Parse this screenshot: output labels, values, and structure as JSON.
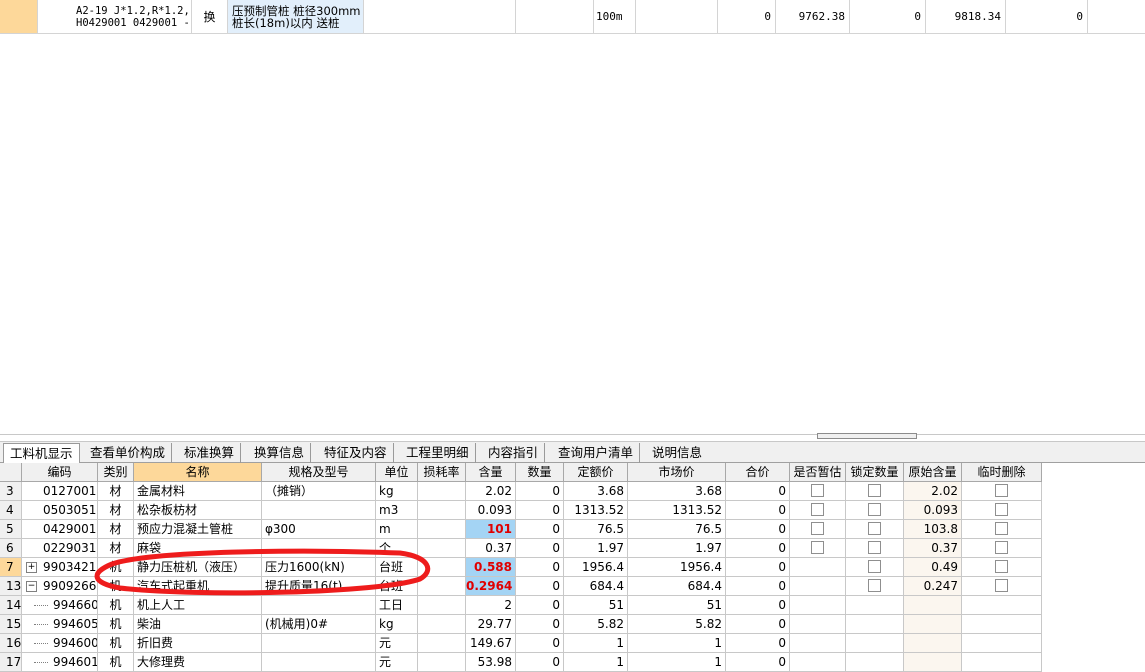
{
  "top_row": {
    "code_lines": [
      "A2-19 J*1.2,R*1.2,",
      "H0429001 0429001 -"
    ],
    "type": "换",
    "name_lines": [
      "压预制管桩 桩径300mm",
      "桩长(18m)以内 送桩"
    ],
    "unit": "100m",
    "v1": "0",
    "v2": "9762.38",
    "v3": "0",
    "v4": "9818.34",
    "v5": "0"
  },
  "tabs": [
    {
      "label": "工料机显示",
      "active": true
    },
    {
      "label": "查看单价构成"
    },
    {
      "label": "标准换算"
    },
    {
      "label": "换算信息"
    },
    {
      "label": "特征及内容"
    },
    {
      "label": "工程里明细"
    },
    {
      "label": "内容指引"
    },
    {
      "label": "查询用户清单"
    },
    {
      "label": "说明信息"
    }
  ],
  "columns": [
    "编码",
    "类别",
    "名称",
    "规格及型号",
    "单位",
    "损耗率",
    "含量",
    "数量",
    "定额价",
    "市场价",
    "合价",
    "是否暂估",
    "锁定数量",
    "原始含量",
    "临时删除"
  ],
  "rows": [
    {
      "no": "3",
      "code": "0127001",
      "type": "材",
      "name": "金属材料",
      "spec": "（摊销）",
      "unit": "kg",
      "loss": "",
      "qty": "2.02",
      "amount": "0",
      "quota": "3.68",
      "market": "3.68",
      "total": "0",
      "est": true,
      "lock": true,
      "orig": "2.02",
      "del": true
    },
    {
      "no": "4",
      "code": "0503051",
      "type": "材",
      "name": "松杂板枋材",
      "spec": "",
      "unit": "m3",
      "loss": "",
      "qty": "0.093",
      "amount": "0",
      "quota": "1313.52",
      "market": "1313.52",
      "total": "0",
      "est": true,
      "lock": true,
      "orig": "0.093",
      "del": true
    },
    {
      "no": "5",
      "code": "0429001",
      "type": "材",
      "name": "预应力混凝土管桩",
      "spec": "φ300",
      "unit": "m",
      "loss": "",
      "qty": "101",
      "amount": "0",
      "quota": "76.5",
      "market": "76.5",
      "total": "0",
      "est": true,
      "lock": true,
      "orig": "103.8",
      "del": true
    },
    {
      "no": "6",
      "code": "0229031",
      "type": "材",
      "name": "麻袋",
      "spec": "",
      "unit": "个",
      "loss": "",
      "qty": "0.37",
      "amount": "0",
      "quota": "1.97",
      "market": "1.97",
      "total": "0",
      "est": true,
      "lock": true,
      "orig": "0.37",
      "del": true
    },
    {
      "no": "7",
      "code": "9903421",
      "type": "机",
      "name": "静力压桩机（液压）",
      "spec": "压力1600(kN)",
      "unit": "台班",
      "loss": "",
      "qty": "0.588",
      "amount": "0",
      "quota": "1956.4",
      "market": "1956.4",
      "total": "0",
      "est": false,
      "lock": true,
      "orig": "0.49",
      "del": true
    },
    {
      "no": "13",
      "code": "9909266",
      "type": "机",
      "name": "汽车式起重机",
      "spec": "提升质量16(t)",
      "unit": "台班",
      "loss": "",
      "qty": "0.2964",
      "amount": "0",
      "quota": "684.4",
      "market": "684.4",
      "total": "0",
      "est": false,
      "lock": true,
      "orig": "0.247",
      "del": true
    },
    {
      "no": "14",
      "code": "994660",
      "type": "机",
      "name": "机上人工",
      "spec": "",
      "unit": "工日",
      "loss": "",
      "qty": "2",
      "amount": "0",
      "quota": "51",
      "market": "51",
      "total": "0",
      "est": false,
      "lock": false,
      "orig": "",
      "del": false
    },
    {
      "no": "15",
      "code": "994605",
      "type": "机",
      "name": "柴油",
      "spec": "(机械用)0#",
      "unit": "kg",
      "loss": "",
      "qty": "29.77",
      "amount": "0",
      "quota": "5.82",
      "market": "5.82",
      "total": "0",
      "est": false,
      "lock": false,
      "orig": "",
      "del": false
    },
    {
      "no": "16",
      "code": "994600",
      "type": "机",
      "name": "折旧费",
      "spec": "",
      "unit": "元",
      "loss": "",
      "qty": "149.67",
      "amount": "0",
      "quota": "1",
      "market": "1",
      "total": "0",
      "est": false,
      "lock": false,
      "orig": "",
      "del": false
    },
    {
      "no": "17",
      "code": "994601",
      "type": "机",
      "name": "大修理费",
      "spec": "",
      "unit": "元",
      "loss": "",
      "qty": "53.98",
      "amount": "0",
      "quota": "1",
      "market": "1",
      "total": "0",
      "est": false,
      "lock": false,
      "orig": "",
      "del": false
    }
  ]
}
